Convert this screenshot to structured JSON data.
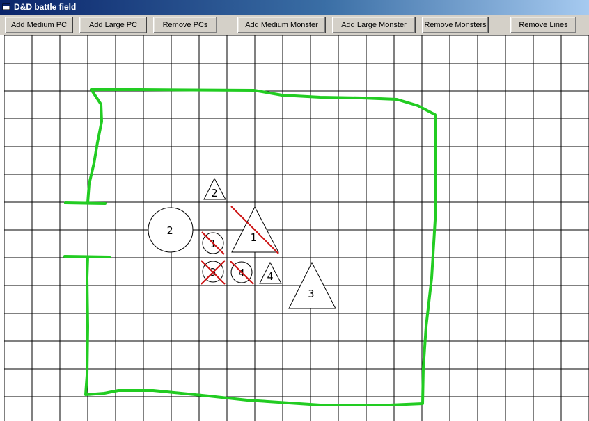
{
  "window": {
    "title": "D&D battle field"
  },
  "toolbar": {
    "buttons": [
      {
        "label": "Add Medium PC"
      },
      {
        "label": "Add Large PC"
      },
      {
        "label": "Remove PCs"
      },
      {
        "label": "Add Medium Monster"
      },
      {
        "label": "Add Large Monster"
      },
      {
        "label": "Remove Monsters"
      },
      {
        "label": "Remove Lines"
      }
    ]
  },
  "battlefield": {
    "grid_color": "#000000",
    "line_color": "#22cc22",
    "strike_color": "#cc1111",
    "pcs": [
      {
        "label": "2",
        "size": "large",
        "struck": false
      },
      {
        "label": "1",
        "size": "medium",
        "struck": true
      },
      {
        "label": "3",
        "size": "medium",
        "struck": true
      },
      {
        "label": "4",
        "size": "medium",
        "struck": true
      }
    ],
    "monsters": [
      {
        "label": "2",
        "size": "medium",
        "struck": false
      },
      {
        "label": "1",
        "size": "large",
        "struck": true
      },
      {
        "label": "4",
        "size": "medium",
        "struck": false
      },
      {
        "label": "3",
        "size": "large",
        "struck": false
      }
    ]
  }
}
